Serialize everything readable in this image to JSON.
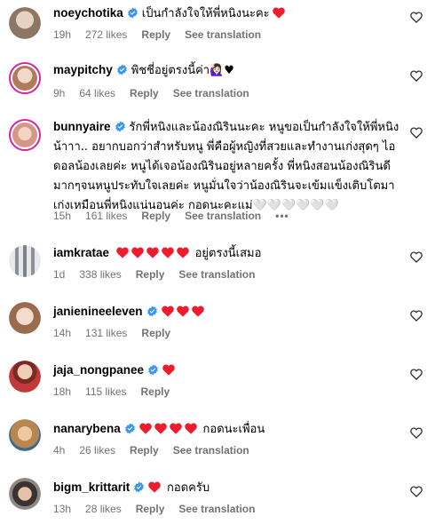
{
  "comments": [
    {
      "username": "noeychotika",
      "text": "เป็นกำลังใจให้พี่หนิงนะคะ",
      "hearts_after_text": 1,
      "hearts_before_text": 0,
      "time": "19h",
      "likes": "272 likes",
      "reply": "Reply",
      "translate": "See translation",
      "avatar_color": "#c9b9a8"
    },
    {
      "username": "maypitchy",
      "text": "พิชชี่อยู่ตรงนี้ค่า🙋🏻‍♀️♥",
      "hearts_after_text": 0,
      "hearts_before_text": 0,
      "time": "9h",
      "likes": "64 likes",
      "reply": "Reply",
      "translate": "See translation",
      "avatar_color": "#d8b7a6"
    },
    {
      "username": "bunnyaire",
      "text": "รักพี่หนิงและน้องณิรินนะคะ หนูขอเป็นกำลังใจให้พี่หนิงน้าาา.. อยากบอกว่าสำหรับหนู พี่คือผู้หญิงที่สวยและทำงานเก่งสุดๆ ไอดอลน้องเลยค่ะ หนูได้เจอน้องณิรินอยู่หลายครั้ง พี่หนิงสอนน้องณิรินดีมากๆจนหนูประทับใจเลยค่ะ หนูมั่นใจว่าน้องณิรินจะเข้มแข็งเติบโตมาเก่งเหมือนพี่หนิงแน่นอนค่ะ กอดนะคะแม่🤍🤍🤍🤍🤍🤍",
      "hearts_after_text": 0,
      "hearts_before_text": 0,
      "time": "15h",
      "likes": "161 likes",
      "reply": "Reply",
      "translate": "See translation",
      "more": "•••",
      "avatar_color": "#e8b4a0"
    },
    {
      "username": "iamkratae",
      "text": "อยู่ตรงนี้เสมอ",
      "hearts_before_text": 5,
      "hearts_after_text": 0,
      "time": "1d",
      "likes": "338 likes",
      "reply": "Reply",
      "translate": "See translation",
      "avatar_color": "#bfc6cc"
    },
    {
      "username": "janienineeleven",
      "text": "",
      "hearts_before_text": 3,
      "hearts_after_text": 0,
      "time": "14h",
      "likes": "131 likes",
      "reply": "Reply",
      "avatar_color": "#d1a98e"
    },
    {
      "username": "jaja_nongpanee",
      "text": "",
      "hearts_before_text": 1,
      "hearts_after_text": 0,
      "time": "18h",
      "likes": "115 likes",
      "reply": "Reply",
      "avatar_color": "#c0393b"
    },
    {
      "username": "nanarybena",
      "text": "กอดนะเพื่อน",
      "hearts_before_text": 4,
      "hearts_after_text": 0,
      "time": "4h",
      "likes": "26 likes",
      "reply": "Reply",
      "translate": "See translation",
      "avatar_color": "#c49a6c"
    },
    {
      "username": "bigm_krittarit",
      "text": "กอดครับ",
      "hearts_before_text": 1,
      "hearts_after_text": 0,
      "time": "13h",
      "likes": "28 likes",
      "reply": "Reply",
      "translate": "See translation",
      "avatar_color": "#6f6a66"
    }
  ],
  "colors": {
    "heart": "#ed1c2e",
    "verified": "#3897f0",
    "meta": "#737373",
    "story_ring": "#d6249f"
  }
}
